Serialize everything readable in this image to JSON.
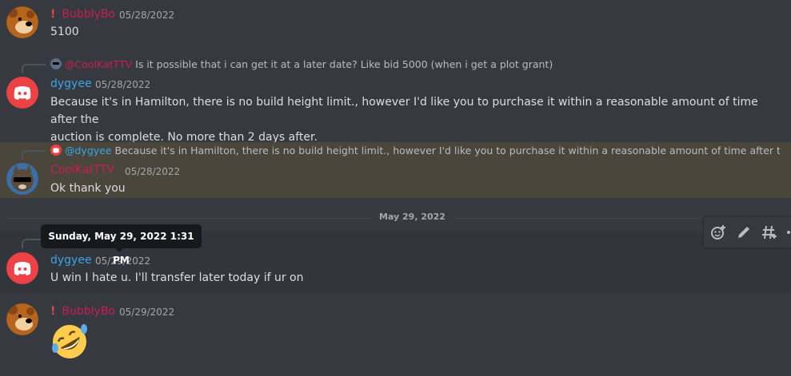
{
  "messages": [
    {
      "author": "BubblyBo",
      "author_prefix": "!",
      "author_color": "#c61f52",
      "timestamp": "05/28/2022",
      "text": "5100"
    },
    {
      "reply": {
        "author": "@CoolKatTTV",
        "text": "Is it possible that i can get it at a later date? Like bid 5000 (when i get a plot grant)"
      },
      "author": "dygyee",
      "author_color": "#3ba4e8",
      "timestamp": "05/28/2022",
      "text_line1": "Because it's in Hamilton, there is no build height limit., however I'd like you to purchase it within a reasonable amount of time after the",
      "text_line2": "auction is complete. No more than 2 days after."
    },
    {
      "reply": {
        "author": "@dygyee",
        "text": "Because it's in Hamilton, there is no build height limit., however I'd like you to purchase it within a reasonable amount of time after the auction ..."
      },
      "author": "CoolKatTTV",
      "author_color": "#c61f52",
      "timestamp": "05/28/2022",
      "text": "Ok thank you"
    },
    {
      "reply": {
        "author": "",
        "text": ""
      },
      "author": "dygyee",
      "author_color": "#3ba4e8",
      "timestamp": "05/29/2022",
      "text": "U win I hate u. I'll transfer later today if ur on"
    },
    {
      "author": "BubblyBo",
      "author_prefix": "!",
      "author_color": "#c61f52",
      "timestamp": "05/29/2022",
      "emoji": "rolling-on-the-floor-laughing"
    }
  ],
  "date_divider": "May 29, 2022",
  "tooltip": "Sunday, May 29, 2022 1:31 PM",
  "toolbar": {
    "icons": [
      "add-reaction-icon",
      "edit-icon",
      "create-thread-icon",
      "more-icon"
    ]
  },
  "colors": {
    "background": "#36393f",
    "highlight": "#4a463c",
    "discord_blurple_red": "#ed4245",
    "link_blue": "#3ba4e8"
  }
}
